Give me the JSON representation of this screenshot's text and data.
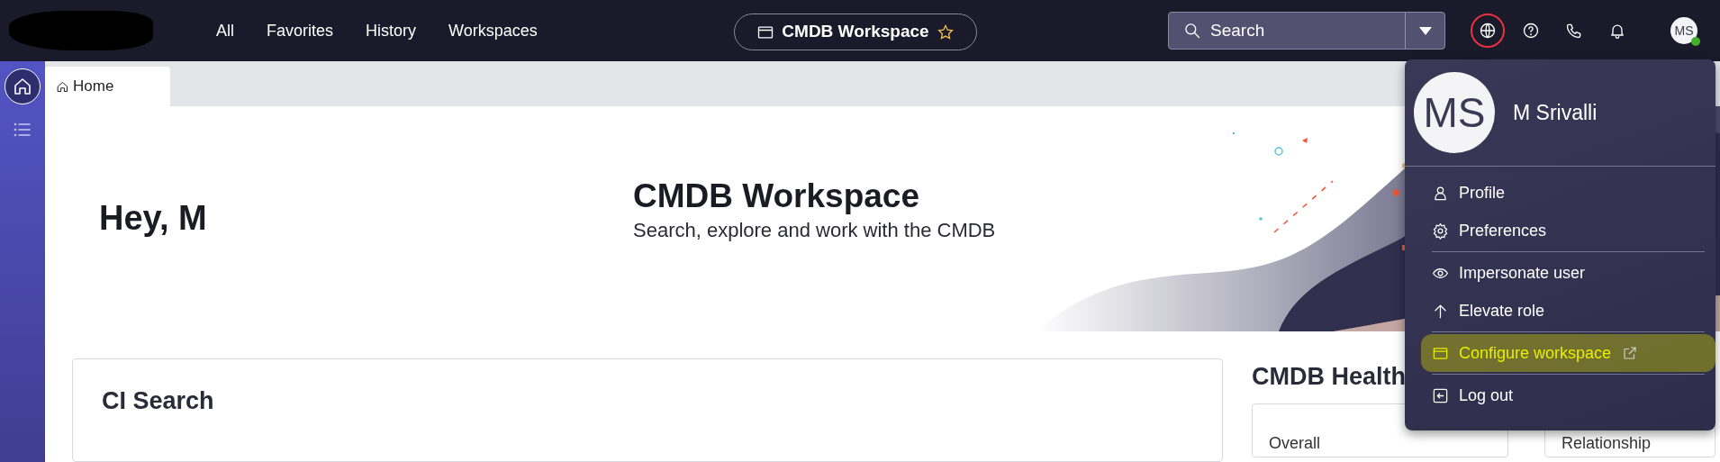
{
  "navbar": {
    "nav_links": [
      "All",
      "Favorites",
      "History",
      "Workspaces"
    ],
    "workspace_pill": {
      "label": "CMDB Workspace"
    },
    "search": {
      "placeholder": "Search"
    },
    "icons": [
      {
        "kind": "globe",
        "focused": true
      },
      {
        "kind": "help",
        "focused": false
      },
      {
        "kind": "phone",
        "focused": false
      },
      {
        "kind": "bell",
        "focused": false
      }
    ],
    "avatar": {
      "initials": "MS",
      "online": true
    }
  },
  "sidebar": {
    "items": [
      {
        "kind": "home",
        "selected": true
      },
      {
        "kind": "list",
        "selected": false
      }
    ]
  },
  "tabs": [
    {
      "label": "Home",
      "selected": true
    }
  ],
  "banner": {
    "greeting": "Hey, M",
    "title": "CMDB Workspace",
    "subtitle": "Search, explore and work with the CMDB"
  },
  "ci_search": {
    "title": "CI Search"
  },
  "health": {
    "title": "CMDB Health",
    "cards": [
      {
        "label": "Overall"
      },
      {
        "label": "Relationship"
      }
    ]
  },
  "user_menu": {
    "initials": "MS",
    "name": "M Srivalli",
    "groups": [
      [
        {
          "kind": "profile",
          "label": "Profile",
          "external": false,
          "highlighted": false
        },
        {
          "kind": "preferences",
          "label": "Preferences",
          "external": false,
          "highlighted": false
        }
      ],
      [
        {
          "kind": "impersonate",
          "label": "Impersonate user",
          "external": false,
          "highlighted": false
        },
        {
          "kind": "elevate",
          "label": "Elevate role",
          "external": false,
          "highlighted": false
        }
      ],
      [
        {
          "kind": "configure",
          "label": "Configure workspace",
          "external": true,
          "highlighted": true
        }
      ],
      [
        {
          "kind": "logout",
          "label": "Log out",
          "external": false,
          "highlighted": false
        }
      ]
    ]
  }
}
